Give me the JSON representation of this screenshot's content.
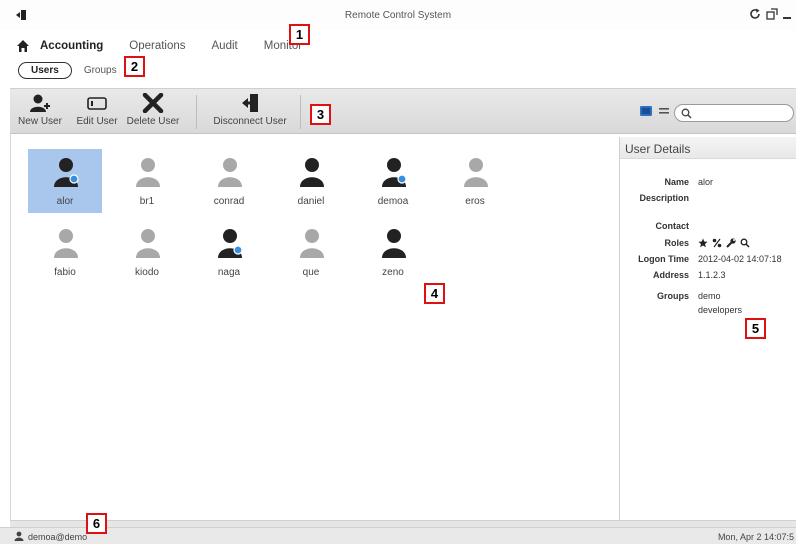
{
  "window": {
    "title": "Remote Control System"
  },
  "nav": {
    "items": [
      {
        "label": "Accounting",
        "active": true
      },
      {
        "label": "Operations",
        "active": false
      },
      {
        "label": "Audit",
        "active": false
      },
      {
        "label": "Monitor",
        "active": false
      }
    ]
  },
  "subnav": {
    "users": "Users",
    "groups": "Groups"
  },
  "toolbar": {
    "new_user": "New User",
    "edit_user": "Edit User",
    "delete_user": "Delete User",
    "disconnect_user": "Disconnect User",
    "search_placeholder": ""
  },
  "users": [
    {
      "name": "alor",
      "tone": "dark",
      "online": true,
      "selected": true
    },
    {
      "name": "br1",
      "tone": "light",
      "online": false,
      "selected": false
    },
    {
      "name": "conrad",
      "tone": "light",
      "online": false,
      "selected": false
    },
    {
      "name": "daniel",
      "tone": "dark",
      "online": false,
      "selected": false
    },
    {
      "name": "demoa",
      "tone": "dark",
      "online": true,
      "selected": false
    },
    {
      "name": "eros",
      "tone": "light",
      "online": false,
      "selected": false
    },
    {
      "name": "fabio",
      "tone": "light",
      "online": false,
      "selected": false
    },
    {
      "name": "kiodo",
      "tone": "light",
      "online": false,
      "selected": false
    },
    {
      "name": "naga",
      "tone": "dark",
      "online": true,
      "selected": false
    },
    {
      "name": "que",
      "tone": "light",
      "online": false,
      "selected": false
    },
    {
      "name": "zeno",
      "tone": "dark",
      "online": false,
      "selected": false
    }
  ],
  "details": {
    "header": "User Details",
    "name_label": "Name",
    "name_value": "alor",
    "description_label": "Description",
    "description_value": "",
    "contact_label": "Contact",
    "contact_value": "",
    "roles_label": "Roles",
    "roles_icons": [
      "star-icon",
      "percent-icon",
      "wrench-icon",
      "magnifier-icon"
    ],
    "logon_label": "Logon Time",
    "logon_value": "2012-04-02 14:07:18",
    "address_label": "Address",
    "address_value": "1.1.2.3",
    "groups_label": "Groups",
    "groups": [
      "demo",
      "developers"
    ]
  },
  "status": {
    "user": "demoa@demo",
    "datetime": "Mon, Apr 2  14:07:5"
  },
  "callouts": [
    "1",
    "2",
    "3",
    "4",
    "5",
    "6"
  ],
  "colors": {
    "selection": "#a9c6ec",
    "online_badge": "#3a8ee0",
    "callout_border": "#dd1111"
  }
}
